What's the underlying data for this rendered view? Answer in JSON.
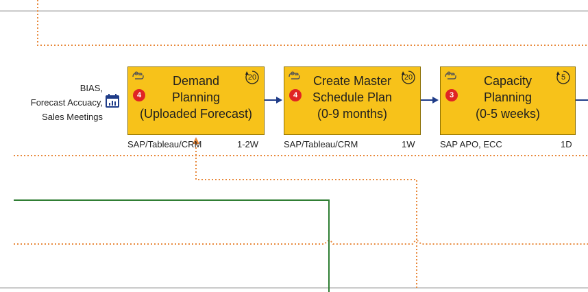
{
  "inputs_text": "BIAS,\nForecast Accuacy,\nSales Meetings",
  "steps": [
    {
      "title": "Demand\nPlanning\n(Uploaded Forecast)",
      "badge": "4",
      "cycle": "20",
      "systems": "SAP/Tableau/CRM",
      "duration": "1-2W"
    },
    {
      "title": "Create Master\nSchedule Plan\n(0-9 months)",
      "badge": "4",
      "cycle": "20",
      "systems": "SAP/Tableau/CRM",
      "duration": "1W"
    },
    {
      "title": "Capacity\nPlanning\n(0-5 weeks)",
      "badge": "3",
      "cycle": "5",
      "systems": "SAP APO, ECC",
      "duration": "1D"
    }
  ],
  "colors": {
    "box_fill": "#f7c21a",
    "arrow": "#1f3c88",
    "dotted_line": "#e8883a",
    "green_line": "#2e7d32",
    "badge": "#e02424"
  }
}
